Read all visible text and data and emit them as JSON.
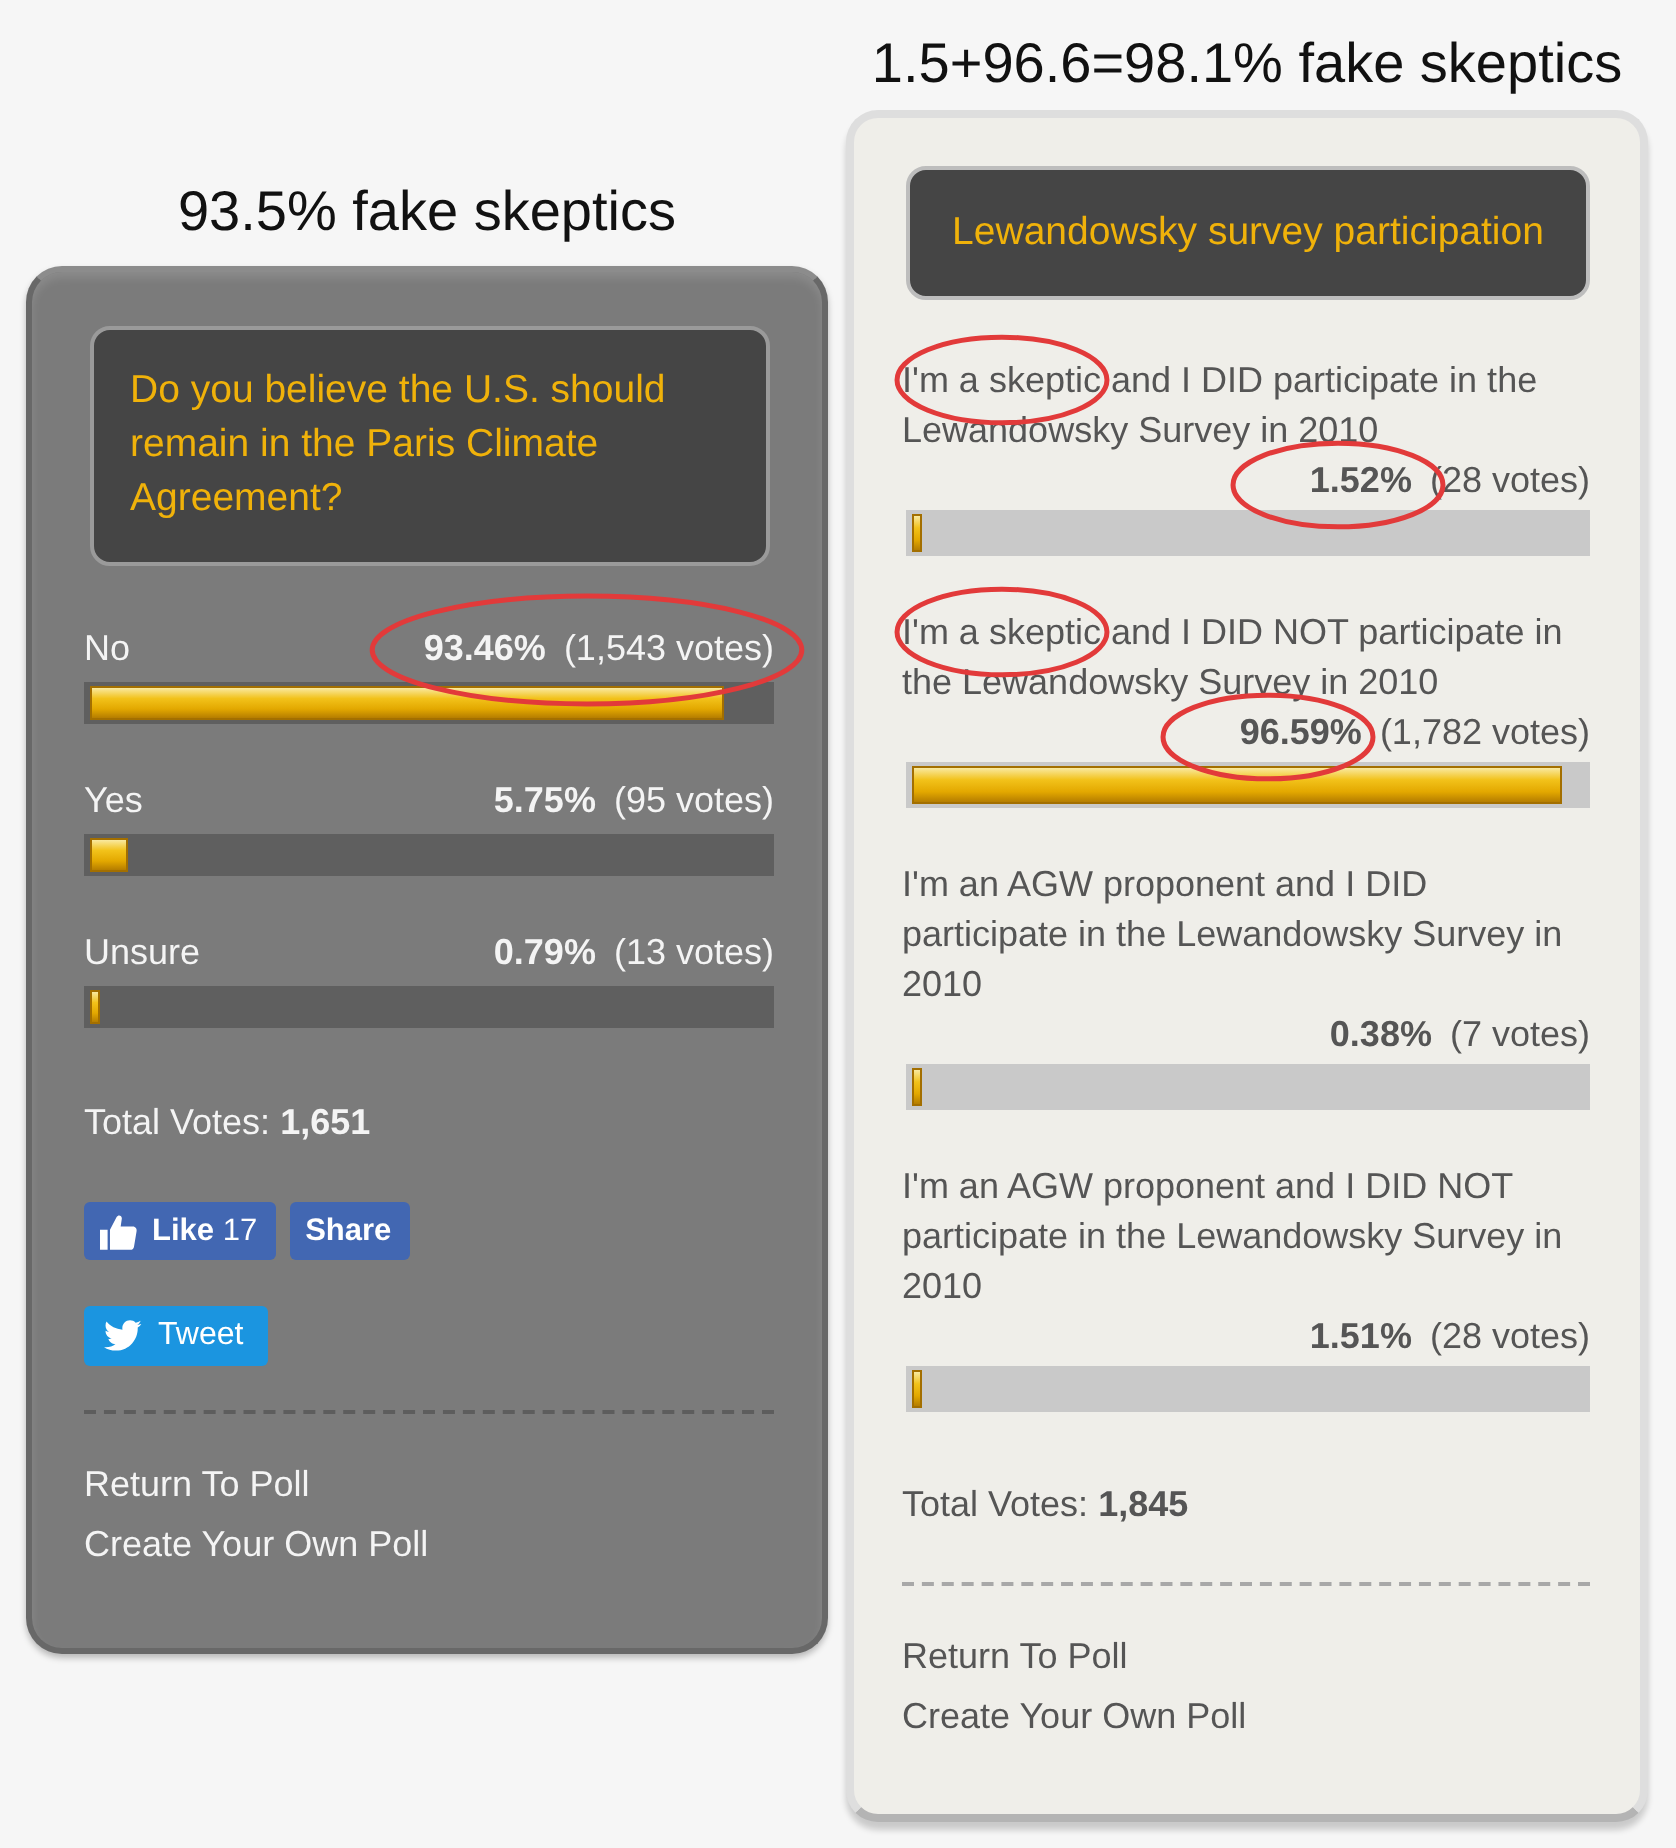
{
  "polls": [
    {
      "caption": "93.5% fake skeptics",
      "kind": "dark",
      "question": "Do you believe the U.S. should remain in the Paris Climate Agreement?",
      "options": [
        {
          "label": "No",
          "percent": "93.46%",
          "votes": "(1,543 votes)",
          "level": 0.9346,
          "label_circled": false,
          "percent_circled": true
        },
        {
          "label": "Yes",
          "percent": "5.75%",
          "votes": "(95 votes)",
          "level": 0.0575,
          "label_circled": false,
          "percent_circled": false
        },
        {
          "label": "Unsure",
          "percent": "0.79%",
          "votes": "(13 votes)",
          "level": 0.0079,
          "label_circled": false,
          "percent_circled": false
        }
      ],
      "total": "Total Votes: **1,651**",
      "social_rows": [
        {
          "buttons": [
            {
              "kind": "like",
              "label": "**Like** 17"
            },
            {
              "kind": "share",
              "label": "Share"
            }
          ]
        },
        {
          "buttons": [
            {
              "kind": "tweet",
              "label": "Tweet"
            }
          ]
        }
      ],
      "links": [
        "Return To Poll",
        "Create Your Own Poll"
      ]
    },
    {
      "caption": "1.5+96.6=98.1% fake skeptics",
      "kind": "light",
      "question": "Lewandowsky survey participation",
      "options": [
        {
          "label": "I'm a skeptic and I DID participate in the Lewandowsky Survey in 2010",
          "percent": "1.52%",
          "votes": "(28 votes)",
          "level": 0.0152,
          "label_circled": true,
          "percent_circled": true
        },
        {
          "label": "I'm a skeptic and I DID NOT participate in the Lewandowsky Survey in 2010",
          "percent": "96.59%",
          "votes": "(1,782 votes)",
          "level": 0.9659,
          "label_circled": true,
          "percent_circled": true
        },
        {
          "label": "I'm an AGW proponent and I DID participate in the Lewandowsky Survey in 2010",
          "percent": "0.38%",
          "votes": "(7 votes)",
          "level": 0.0038,
          "label_circled": false,
          "percent_circled": false
        },
        {
          "label": "I'm an AGW proponent and I DID NOT participate in the Lewandowsky Survey in 2010",
          "percent": "1.51%",
          "votes": "(28 votes)",
          "level": 0.0151,
          "label_circled": false,
          "percent_circled": false
        }
      ],
      "total": "Total Votes: **1,845**",
      "links": [
        "Return To Poll",
        "Create Your Own Poll"
      ]
    }
  ]
}
